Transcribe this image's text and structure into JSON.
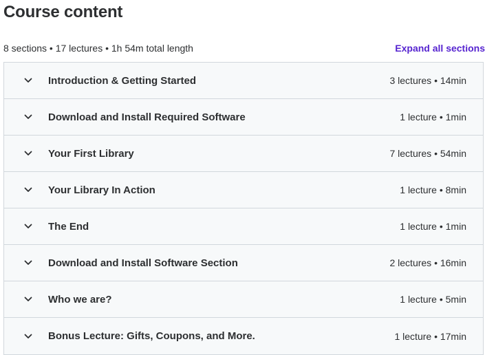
{
  "header": {
    "title": "Course content",
    "summary": "8 sections • 17 lectures • 1h 54m total length",
    "expand_all_label": "Expand all sections"
  },
  "colors": {
    "accent": "#5624d0",
    "section_bg": "#f7f9fa",
    "border": "#d1d7dc"
  },
  "sections": [
    {
      "title": "Introduction & Getting Started",
      "meta": "3 lectures • 14min",
      "icon": "chevron-down-icon"
    },
    {
      "title": "Download and Install Required Software",
      "meta": "1 lecture • 1min",
      "icon": "chevron-down-icon"
    },
    {
      "title": "Your First Library",
      "meta": "7 lectures • 54min",
      "icon": "chevron-down-icon"
    },
    {
      "title": "Your Library In Action",
      "meta": "1 lecture • 8min",
      "icon": "chevron-down-icon"
    },
    {
      "title": "The End",
      "meta": "1 lecture • 1min",
      "icon": "chevron-down-icon"
    },
    {
      "title": "Download and Install Software Section",
      "meta": "2 lectures • 16min",
      "icon": "chevron-down-icon"
    },
    {
      "title": "Who we are?",
      "meta": "1 lecture • 5min",
      "icon": "chevron-down-icon"
    },
    {
      "title": "Bonus Lecture: Gifts, Coupons, and More.",
      "meta": "1 lecture • 17min",
      "icon": "chevron-down-icon"
    }
  ]
}
